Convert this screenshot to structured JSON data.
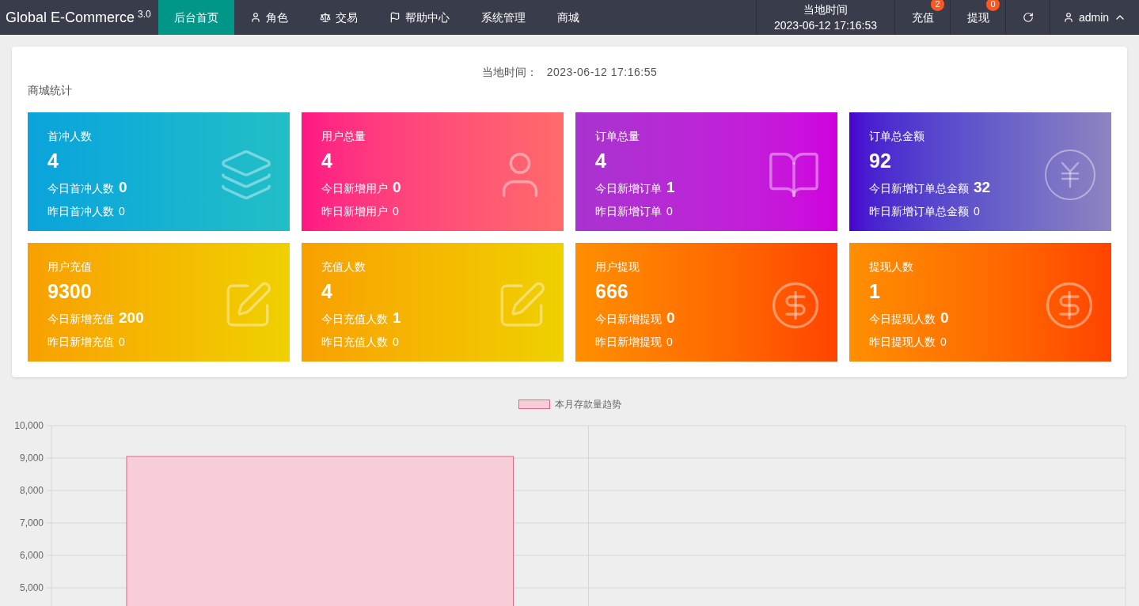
{
  "header": {
    "logo": "Global E-Commerce",
    "version": "3.0",
    "nav": [
      {
        "label": "后台首页",
        "selected": true
      },
      {
        "label": "角色",
        "selected": false
      },
      {
        "label": "交易",
        "selected": false
      },
      {
        "label": "帮助中心",
        "selected": false
      },
      {
        "label": "系统管理",
        "selected": false
      },
      {
        "label": "商城",
        "selected": false
      }
    ],
    "clock": {
      "label": "当地时间",
      "time": "2023-06-12 17:16:53"
    },
    "actions": [
      {
        "label": "充值",
        "badge": "2"
      },
      {
        "label": "提现",
        "badge": "0"
      }
    ],
    "user": "admin"
  },
  "stats": {
    "time_label": "当地时间：",
    "time": "2023-06-12 17:16:55",
    "title": "商城统计",
    "cards": [
      {
        "title": "首冲人数",
        "value": "4",
        "today_label": "今日首冲人数",
        "today": "0",
        "yesterday_label": "昨日首冲人数",
        "yesterday": "0"
      },
      {
        "title": "用户总量",
        "value": "4",
        "today_label": "今日新增用户",
        "today": "0",
        "yesterday_label": "昨日新增用户",
        "yesterday": "0"
      },
      {
        "title": "订单总量",
        "value": "4",
        "today_label": "今日新增订单",
        "today": "1",
        "yesterday_label": "昨日新增订单",
        "yesterday": "0"
      },
      {
        "title": "订单总金额",
        "value": "92",
        "today_label": "今日新增订单总金额",
        "today": "32",
        "yesterday_label": "昨日新增订单总金额",
        "yesterday": "0"
      },
      {
        "title": "用户充值",
        "value": "9300",
        "today_label": "今日新增充值",
        "today": "200",
        "yesterday_label": "昨日新增充值",
        "yesterday": "0"
      },
      {
        "title": "充值人数",
        "value": "4",
        "today_label": "今日充值人数",
        "today": "1",
        "yesterday_label": "昨日充值人数",
        "yesterday": "0"
      },
      {
        "title": "用户提现",
        "value": "666",
        "today_label": "今日新增提现",
        "today": "0",
        "yesterday_label": "昨日新增提现",
        "yesterday": "0"
      },
      {
        "title": "提现人数",
        "value": "1",
        "today_label": "今日提现人数",
        "today": "0",
        "yesterday_label": "昨日提现人数",
        "yesterday": "0"
      }
    ]
  },
  "chart": {
    "chart_data": {
      "type": "bar",
      "grid": true,
      "ylim": [
        0,
        10000
      ],
      "yticks": [
        {
          "value": 5000,
          "label": "5,000"
        },
        {
          "value": 6000,
          "label": "6,000"
        },
        {
          "value": 7000,
          "label": "7,000"
        },
        {
          "value": 8000,
          "label": "8,000"
        },
        {
          "value": 9000,
          "label": "9,000"
        },
        {
          "value": 10000,
          "label": "10,000"
        }
      ],
      "series": [
        {
          "name": "本月存款量趋势",
          "color": "#f7cdd7",
          "values": [
            9050,
            null
          ]
        }
      ]
    }
  }
}
